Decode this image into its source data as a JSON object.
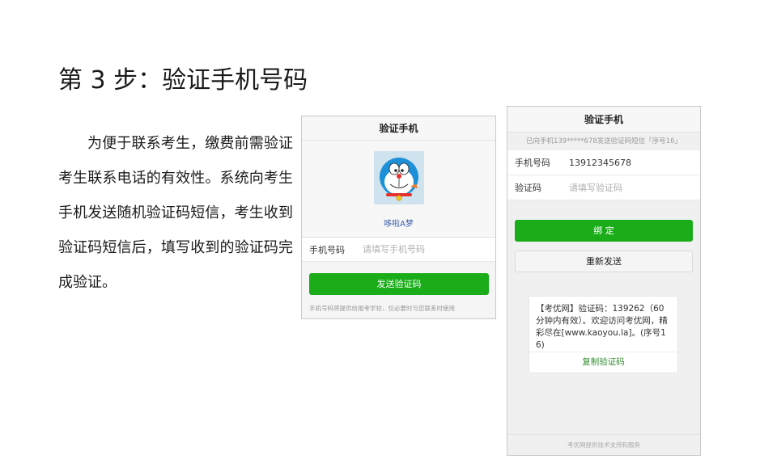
{
  "step_title": "第 3 步：验证手机号码",
  "description": "为便于联系考生，缴费前需验证考生联系电话的有效性。系统向考生手机发送随机验证码短信，考生收到验证码短信后，填写收到的验证码完成验证。",
  "screen1": {
    "title": "验证手机",
    "nickname": "哆啦A梦",
    "phone_label": "手机号码",
    "phone_placeholder": "请填写手机号码",
    "send_button": "发送验证码",
    "note": "手机号码将提供给报考学校，仅必要时与您联系时使用"
  },
  "screen2": {
    "title": "验证手机",
    "info": "已向手机139*****678发送验证码短信「序号16」",
    "phone_label": "手机号码",
    "phone_value": "13912345678",
    "code_label": "验证码",
    "code_placeholder": "请填写验证码",
    "bind_button": "绑 定",
    "resend_button": "重新发送",
    "sms_text": "【考优网】验证码：139262（60分钟内有效）。欢迎访问考优网，精彩尽在[www.kaoyou.la]。(序号16)",
    "copy_button": "复制验证码",
    "footer": "考优网提供技术支持和服务"
  },
  "colors": {
    "primary_green": "#1aad19",
    "link_blue": "#3a5fa8",
    "copy_green": "#2f8f2f"
  }
}
